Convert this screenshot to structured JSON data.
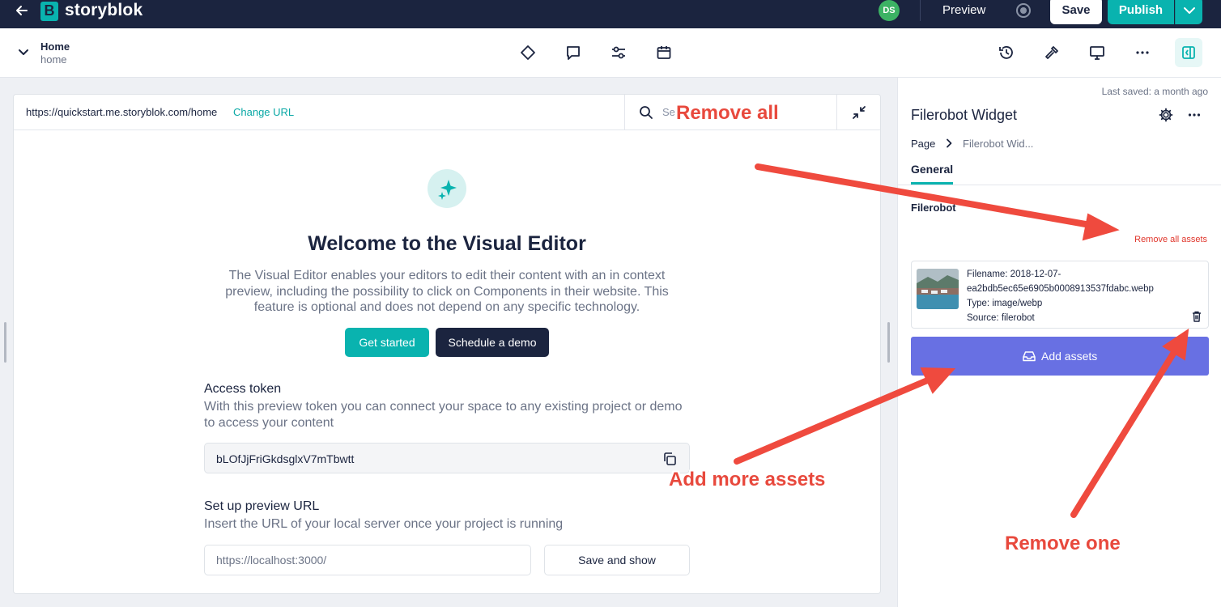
{
  "topbar": {
    "brand": "storyblok",
    "logo_letter": "B",
    "avatar_initials": "DS",
    "preview_label": "Preview",
    "save_label": "Save",
    "publish_label": "Publish"
  },
  "story": {
    "name": "Home",
    "slug": "home"
  },
  "toolbar_center_icons": [
    "diamond-icon",
    "comment-icon",
    "sliders-icon",
    "calendar-icon"
  ],
  "toolbar_right_icons": [
    "history-icon",
    "tools-icon",
    "desktop-icon",
    "more-icon",
    "panel-toggle-icon"
  ],
  "preview": {
    "url": "https://quickstart.me.storyblok.com/home",
    "change_url_label": "Change URL",
    "search_placeholder": "Se",
    "welcome_title": "Welcome to the Visual Editor",
    "welcome_desc": "The Visual Editor enables your editors to edit their content with an in context preview, including the possibility to click on Components in their website. This feature is optional and does not depend on any specific technology.",
    "get_started_label": "Get started",
    "schedule_demo_label": "Schedule a demo",
    "access_token_title": "Access token",
    "access_token_desc": "With this preview token you can connect your space to any existing project or demo to access your content",
    "access_token_value": "bLOfJjFriGkdsglxV7mTbwtt",
    "preview_url_title": "Set up preview URL",
    "preview_url_desc": "Insert the URL of your local server once your project is running",
    "preview_url_placeholder": "https://localhost:3000/",
    "save_and_show_label": "Save and show"
  },
  "panel": {
    "last_saved": "Last saved: a month ago",
    "title": "Filerobot Widget",
    "breadcrumb_root": "Page",
    "breadcrumb_current": "Filerobot Wid...",
    "tab_general": "General",
    "field_label": "Filerobot",
    "remove_all_label": "Remove all assets",
    "asset": {
      "filename_line1": "Filename: 2018-12-07-",
      "filename_line2": "ea2bdb5ec65e6905b0008913537fdabc.webp",
      "type": "Type: image/webp",
      "source": "Source: filerobot"
    },
    "add_assets_label": "Add assets"
  },
  "annotations": {
    "remove_all": "Remove all",
    "add_more": "Add more assets",
    "remove_one": "Remove one",
    "color": "#e8493d"
  },
  "colors": {
    "brand_dark": "#1b243f",
    "teal": "#09b3af",
    "add_assets": "#6870e3",
    "danger": "#e0352b"
  }
}
